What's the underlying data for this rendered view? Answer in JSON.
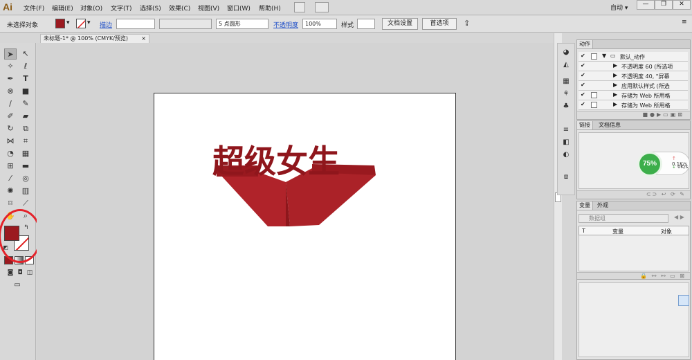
{
  "app": {
    "logo": "Ai"
  },
  "menu": [
    "文件(F)",
    "编辑(E)",
    "对象(O)",
    "文字(T)",
    "选择(S)",
    "效果(C)",
    "视图(V)",
    "窗口(W)",
    "帮助(H)"
  ],
  "workspace": {
    "label": "自动",
    "arrow": "▾"
  },
  "window_controls": {
    "minimize": "—",
    "restore": "❐",
    "close": "✕"
  },
  "control_bar": {
    "selection_status": "未选择对象",
    "stroke_label": "描边",
    "brush_value": "5 点圆形",
    "opacity_label": "不透明度",
    "opacity_value": "100%",
    "style_label": "样式",
    "doc_setup_button": "文档设置",
    "prefs_button": "首选项"
  },
  "document_tab": {
    "title": "未标题-1* @ 100% (CMYK/预览)",
    "close": "×"
  },
  "colors": {
    "fill": "#9b1a20",
    "stroke": "none",
    "artwork": "#b0232a"
  },
  "artwork": {
    "text": "超级女生"
  },
  "panels": {
    "actions": {
      "tab": "动作",
      "rows": [
        {
          "label": "默认_动作",
          "checked": true,
          "folder": true
        },
        {
          "label": "不透明度 60 (所选项",
          "checked": true
        },
        {
          "label": "不透明度 40, \"屏幕",
          "checked": true
        },
        {
          "label": "应用默认样式 (所选",
          "checked": true
        },
        {
          "label": "存储为 Web 所用格",
          "checked": true
        },
        {
          "label": "存储为 Web 所用格",
          "checked": true
        }
      ]
    },
    "links": {
      "tabs": [
        "链接",
        "文档信息"
      ]
    },
    "variables": {
      "tabs": [
        "变量",
        "外观"
      ],
      "dataset_placeholder": "数据组",
      "columns": [
        "T",
        "变量",
        "对象"
      ]
    }
  },
  "network_widget": {
    "percent": "75%",
    "upload": "0.1K/s",
    "download": "0K/s"
  }
}
